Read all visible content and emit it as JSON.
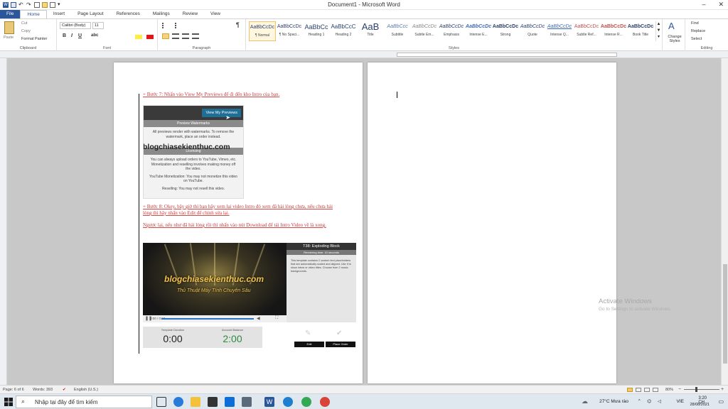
{
  "window": {
    "title": "Document1 - Microsoft Word",
    "minimize": "–",
    "close": "✕"
  },
  "tabs": [
    "File",
    "Home",
    "Insert",
    "Page Layout",
    "References",
    "Mailings",
    "Review",
    "View"
  ],
  "ribbon": {
    "clipboard": {
      "paste": "Paste",
      "cut": "Cut",
      "copy": "Copy",
      "format_painter": "Format Painter",
      "label": "Clipboard"
    },
    "font": {
      "family": "Calibri (Body)",
      "size": "11",
      "label": "Font"
    },
    "paragraph": {
      "label": "Paragraph"
    },
    "styles": {
      "label": "Styles",
      "items": [
        {
          "preview": "AaBbCcDc",
          "name": "¶ Normal"
        },
        {
          "preview": "AaBbCcDc",
          "name": "¶ No Spaci..."
        },
        {
          "preview": "AaBbCc",
          "name": "Heading 1"
        },
        {
          "preview": "AaBbCcC",
          "name": "Heading 2"
        },
        {
          "preview": "AaB",
          "name": "Title"
        },
        {
          "preview": "AaBbCcc",
          "name": "Subtitle"
        },
        {
          "preview": "AaBbCcDc",
          "name": "Subtle Em..."
        },
        {
          "preview": "AaBbCcDc",
          "name": "Emphasis"
        },
        {
          "preview": "AaBbCcDc",
          "name": "Intense E..."
        },
        {
          "preview": "AaBbCcDc",
          "name": "Strong"
        },
        {
          "preview": "AaBbCcDc",
          "name": "Quote"
        },
        {
          "preview": "AaBbCcDc",
          "name": "Intense Q..."
        },
        {
          "preview": "AaBbCcDc",
          "name": "Subtle Ref..."
        },
        {
          "preview": "AaBbCcDc",
          "name": "Intense R..."
        },
        {
          "preview": "AaBbCcDc",
          "name": "Book Title"
        }
      ],
      "change_styles": "Change Styles"
    },
    "editing": {
      "find": "Find",
      "replace": "Replace",
      "select": "Select",
      "label": "Editing"
    }
  },
  "document": {
    "step7": "+ Bước 7: Nhấn vào View My Previews để đi đến kho Intro của bạn.",
    "step8": "+ Bước 8: Okey, bây giờ thì bạn hãy xem lại video Intro đó xem đã hài lòng chưa, nếu chưa hài lòng thì hãy nhấn vào Edit để chỉnh sửa lại.",
    "otherwise": "Ngược lại, nếu như đã hài lòng rồi thì nhấn vào nút Download để tải Intro Video về là xong.",
    "shot1": {
      "button": "View My Previews",
      "watermark_header": "Preview Watermarks",
      "watermark_text": "All previews render with watermarks. To remove the watermark, place an order instead.",
      "site_watermark": "blogchiasekienthuc.com",
      "licensing_header": "Licensing",
      "licensing_text": "You can always upload orders to YouTube, Vimeo, etc. Monetization and reselling involves making money off the video.",
      "monetization": "YouTube Monetization: You may not monetize this video on YouTube.",
      "reselling": "Reselling: You may not resell this video."
    },
    "shot2": {
      "brand": "blogchiasekienthuc.com",
      "subtitle": "Thủ Thuật Máy Tính Chuyên Sâu",
      "time": "0:00 / 0:10",
      "panel_title": "T38: Exploding Block",
      "panel_duration": "Rendering time: 10 seconds",
      "panel_desc": "This template contains 2 custom text placeholders that are automatically scaled and aligned. Use it to show intros or video titles. Choose from 2 music backgrounds.",
      "template_duration_label": "Template Duration",
      "template_duration": "0:00",
      "account_balance_label": "Account Balance",
      "account_balance": "2:00",
      "edit": "Edit",
      "place_order": "Place Order"
    }
  },
  "activation": {
    "title": "Activate Windows",
    "text": "Go to Settings to activate Windows."
  },
  "statusbar": {
    "page": "Page: 6 of 6",
    "words": "Words: 393",
    "language": "English (U.S.)",
    "zoom": "80%"
  },
  "taskbar": {
    "search_placeholder": "Nhập tại đây để tìm kiếm",
    "weather": "27°C  Mưa rào",
    "lang": "VIE",
    "time": "3:20 CH",
    "date": "28/08/2021"
  },
  "colors": {
    "accent": "#2b579a",
    "step_text": "#cc3a3a",
    "balance": "#2e8b3e"
  }
}
